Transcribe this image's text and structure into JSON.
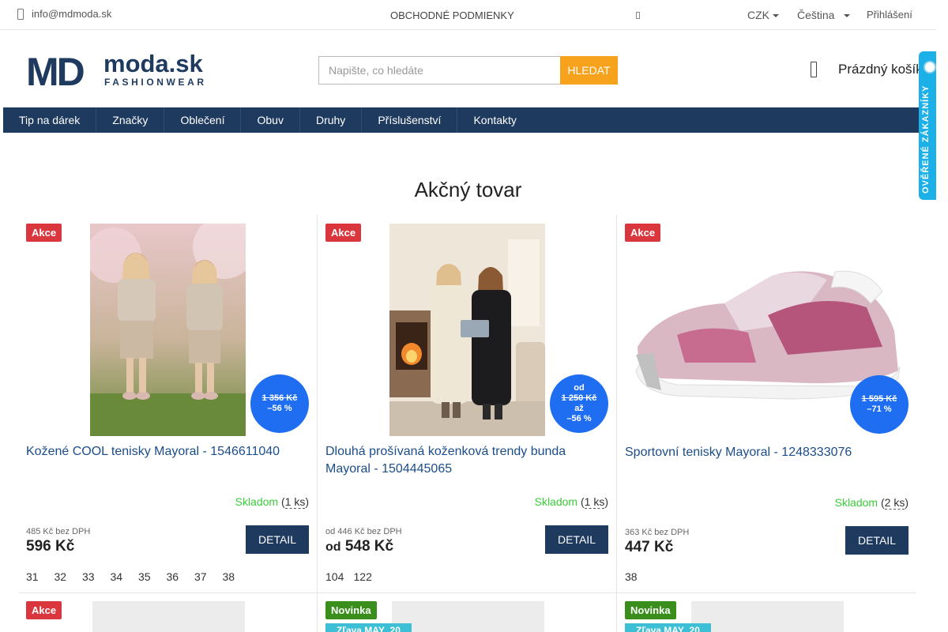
{
  "topbar": {
    "email": "info@mdmoda.sk",
    "terms": "OBCHODNÉ PODMIENKY",
    "currency": "CZK",
    "language": "Čeština",
    "login": "Přihlášení"
  },
  "logo": {
    "main": "MD",
    "text": "moda.sk",
    "sub": "FASHIONWEAR"
  },
  "search": {
    "placeholder": "Napište, co hledáte",
    "button": "HLEDAT"
  },
  "cart": {
    "label": "Prázdný košík"
  },
  "verified": {
    "label": "OVĚŘENÉ ZÁKAZNÍKY"
  },
  "nav": [
    "Tip na dárek",
    "Značky",
    "Oblečení",
    "Obuv",
    "Druhy",
    "Příslušenství",
    "Kontakty"
  ],
  "heading": "Akčný tovar",
  "products": [
    {
      "flag": "Akce",
      "circle": {
        "prefix": "",
        "old": "1 356 Kč",
        "mid": "",
        "discount": "–56 %"
      },
      "title": "Kožené COOL tenisky Mayoral - 1546611040",
      "stock": "Skladom",
      "qty": "1 ks",
      "netto": "485 Kč bez DPH",
      "gross_prefix": "",
      "gross": "596 Kč",
      "detail": "DETAIL",
      "sizes": [
        "31",
        "32",
        "33",
        "34",
        "35",
        "36",
        "37",
        "38"
      ]
    },
    {
      "flag": "Akce",
      "circle": {
        "prefix": "od",
        "old": "1 250 Kč",
        "mid": "až",
        "discount": "–56 %"
      },
      "title": "Dlouhá prošívaná koženková trendy bunda Mayoral - 1504445065",
      "stock": "Skladom",
      "qty": "1 ks",
      "netto": "od 446 Kč bez DPH",
      "gross_prefix": "od",
      "gross": "548 Kč",
      "detail": "DETAIL",
      "sizes": [
        "104",
        "122"
      ]
    },
    {
      "flag": "Akce",
      "circle": {
        "prefix": "",
        "old": "1 595 Kč",
        "mid": "",
        "discount": "–71 %"
      },
      "title": "Sportovní tenisky Mayoral - 1248333076",
      "stock": "Skladom",
      "qty": "2 ks",
      "netto": "363 Kč bez DPH",
      "gross_prefix": "",
      "gross": "447 Kč",
      "detail": "DETAIL",
      "sizes": [
        "38"
      ]
    }
  ],
  "row2": [
    {
      "flag": "Akce",
      "promo": ""
    },
    {
      "flag": "Novinka",
      "promo": "Zľava MAY_20"
    },
    {
      "flag": "Novinka",
      "promo": "Zľava MAY_20"
    }
  ],
  "colors": {
    "nav": "#1e3a5f",
    "search_button": "#f7a21c",
    "sale_flag": "#d9363e",
    "new_flag": "#3a8f1c",
    "price_circle": "#1f6ef2",
    "stock_ok": "#3acb3a",
    "promo": "#3dbfd6"
  }
}
